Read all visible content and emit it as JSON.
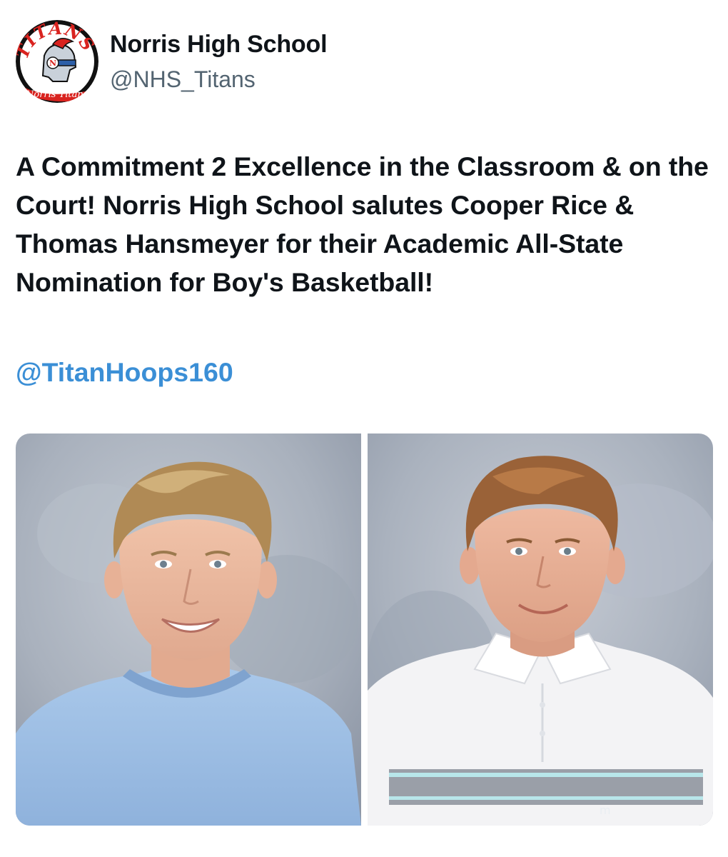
{
  "account": {
    "display_name": "Norris High School",
    "handle": "@NHS_Titans",
    "avatar_icon": "titans-logo-icon",
    "logo_text_top": "TITANS",
    "logo_text_bottom": "Norris Titans",
    "logo_letter": "N"
  },
  "post": {
    "text": "A Commitment 2 Excellence in the Classroom & on the Court! Norris High School salutes Cooper Rice & Thomas Hansmeyer for their Academic All-State Nomination for Boy's Basketball!",
    "mention": "@TitanHoops160"
  },
  "media": {
    "photos": [
      {
        "subject": "student portrait in light blue t-shirt"
      },
      {
        "subject": "student portrait in white polo shirt"
      }
    ]
  },
  "colors": {
    "link": "#3b8fd6",
    "secondary_text": "#536471",
    "logo_red": "#d9231f"
  }
}
